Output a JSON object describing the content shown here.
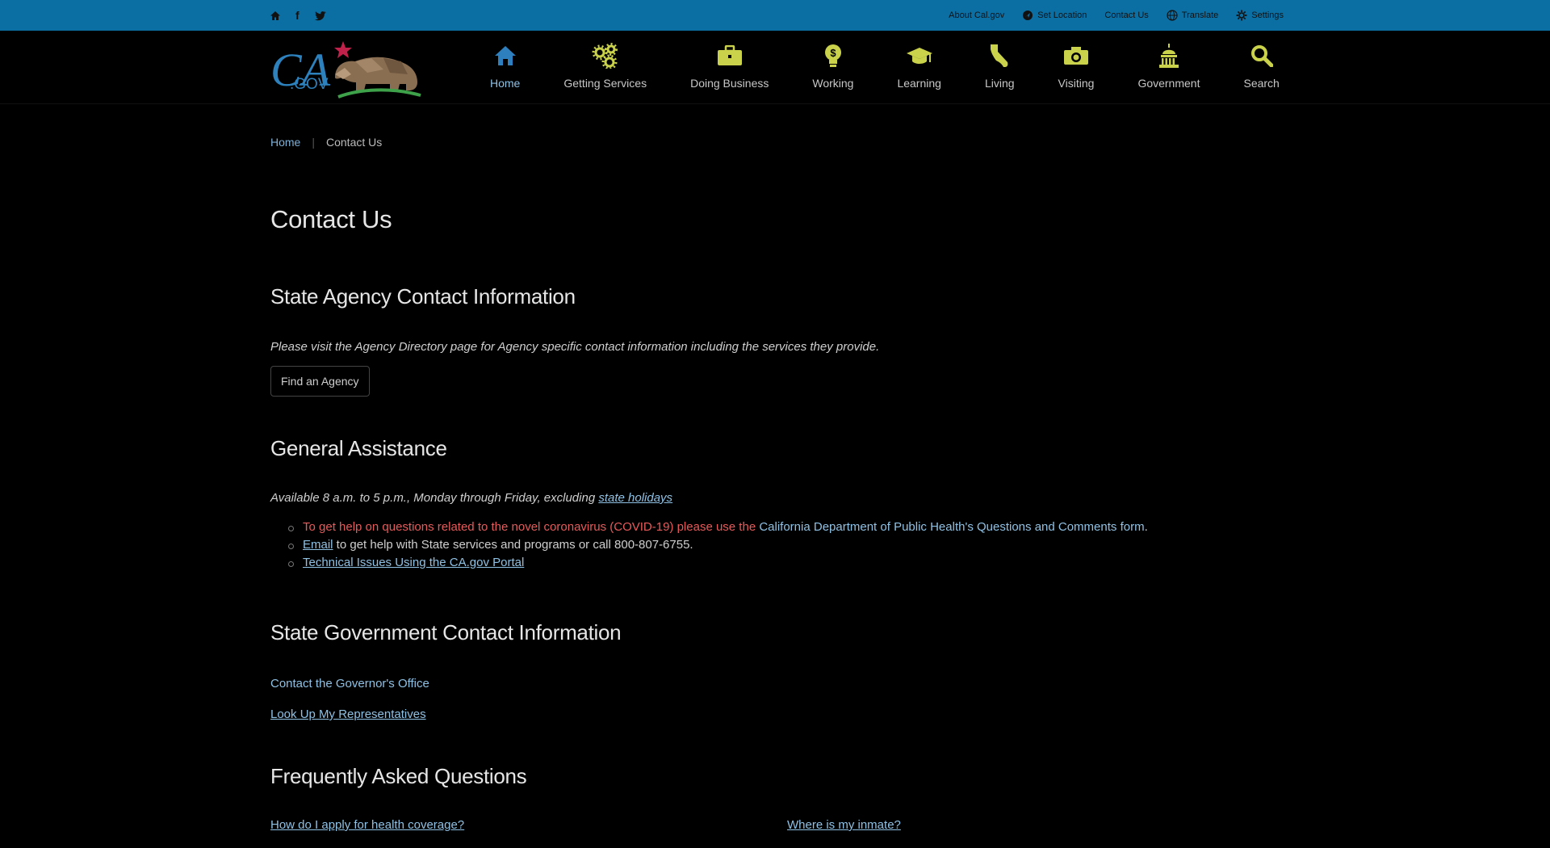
{
  "utility": {
    "about": "About Cal.gov",
    "location": "Set Location",
    "contact": "Contact Us",
    "translate": "Translate",
    "settings": "Settings"
  },
  "nav": {
    "items": [
      {
        "label": "Home"
      },
      {
        "label": "Getting Services"
      },
      {
        "label": "Doing Business"
      },
      {
        "label": "Working"
      },
      {
        "label": "Learning"
      },
      {
        "label": "Living"
      },
      {
        "label": "Visiting"
      },
      {
        "label": "Government"
      },
      {
        "label": "Search"
      }
    ]
  },
  "logo": {
    "text": "CA.GOV"
  },
  "breadcrumb": {
    "home": "Home",
    "current": "Contact Us"
  },
  "page": {
    "title": "Contact Us"
  },
  "agency": {
    "heading": "State Agency Contact Information",
    "intro": "Please visit the Agency Directory page for Agency specific contact information including the services they provide.",
    "button": "Find an Agency"
  },
  "general": {
    "heading": "General Assistance",
    "avail_prefix": "Available 8 a.m. to 5 p.m., Monday through Friday, excluding ",
    "avail_link": "state holidays",
    "covid_text": "To get help on questions related to the novel coronavirus (COVID-19) please use the ",
    "covid_link": "California Department of Public Health's Questions and Comments form",
    "covid_end": ".",
    "email_link": "Email",
    "email_text": " to get help with State services and programs or call 800-807-6755.",
    "tech_link": "Technical Issues Using the CA.gov Portal"
  },
  "government": {
    "heading": "State Government Contact Information",
    "governor": "Contact the Governor's Office",
    "reps": "Look Up My Representatives"
  },
  "faq": {
    "heading": "Frequently Asked Questions",
    "q1": "How do I apply for health coverage?",
    "q2": "Where is my inmate?"
  },
  "colors": {
    "utility_bar": "#0b6fa3",
    "nav_icon": "#c9d24a",
    "active": "#2e7fbd",
    "link": "#8fc1e4"
  }
}
